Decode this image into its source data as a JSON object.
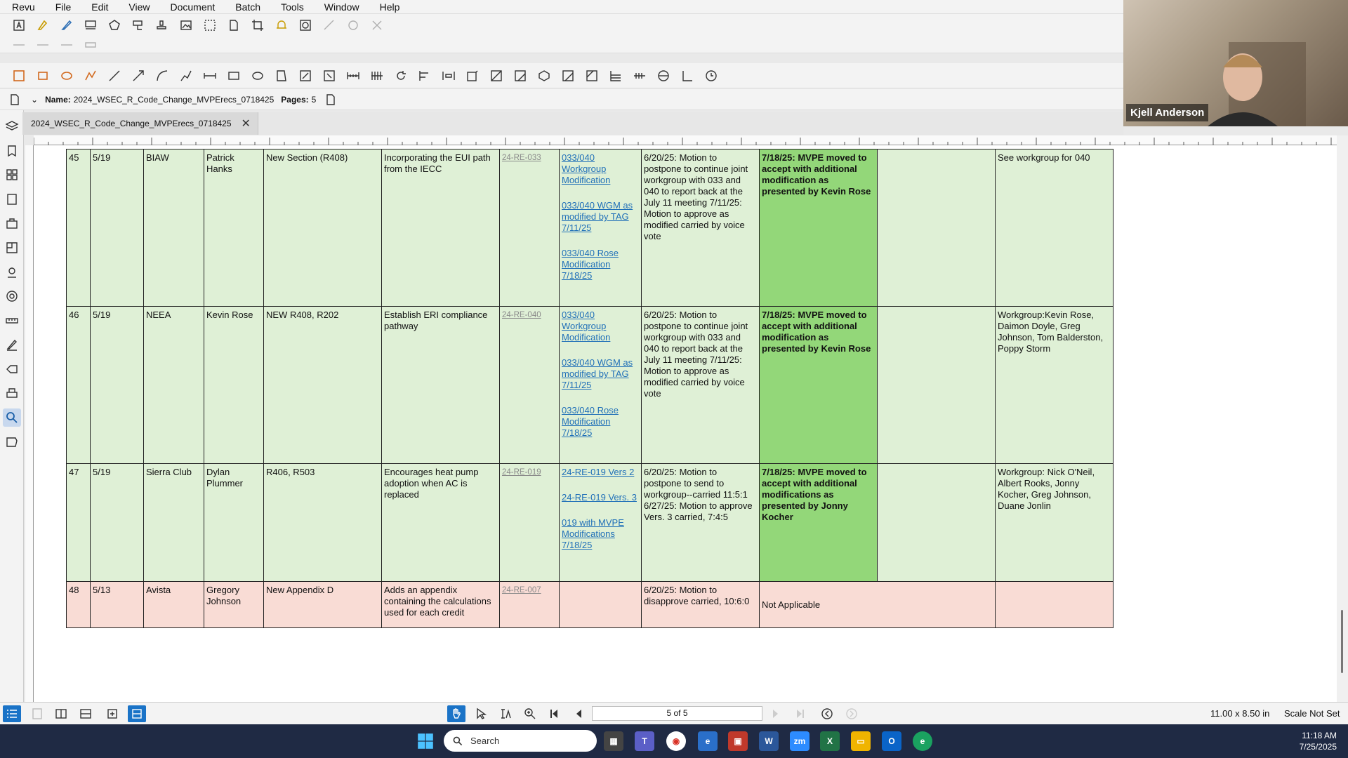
{
  "menu": [
    "Revu",
    "File",
    "Edit",
    "View",
    "Document",
    "Batch",
    "Tools",
    "Window",
    "Help"
  ],
  "namebar": {
    "name_label": "Name:",
    "name_value": "2024_WSEC_R_Code_Change_MVPErecs_0718425",
    "pages_label": "Pages:",
    "pages_value": "5"
  },
  "tab": {
    "title": "2024_WSEC_R_Code_Change_MVPErecs_0718425"
  },
  "table": {
    "rows": [
      {
        "num": "45",
        "date": "5/19",
        "org": "BIAW",
        "person": "Patrick Hanks",
        "section": "New Section (R408)",
        "desc": "Incorporating the EUI path from the IECC",
        "ref": "24-RE-033",
        "links": [
          "033/040 Workgroup Modification",
          "033/040 WGM as modified by TAG 7/11/25",
          "033/040 Rose Modification 7/18/25"
        ],
        "tag": "6/20/25: Motion to postpone to continue joint workgroup with 033 and 040 to report back at the July 11 meeting 7/11/25: Motion to approve as modified carried by voice vote",
        "decision": "7/18/25: MVPE moved to accept with additional modification as presented by Kevin Rose",
        "notes": "See workgroup for 040",
        "type": "green"
      },
      {
        "num": "46",
        "date": "5/19",
        "org": "NEEA",
        "person": "Kevin Rose",
        "section": "NEW R408, R202",
        "desc": "Establish ERI compliance pathway",
        "ref": "24-RE-040",
        "links": [
          "033/040 Workgroup Modification",
          "033/040 WGM as modified by TAG 7/11/25",
          "033/040 Rose Modification 7/18/25"
        ],
        "tag": "6/20/25: Motion to postpone to continue joint workgroup with 033 and 040 to report back at the July 11 meeting 7/11/25: Motion to approve as modified carried by voice vote",
        "decision": "7/18/25: MVPE moved to accept with additional modification as presented by Kevin Rose",
        "notes": "Workgroup:Kevin Rose, Daimon Doyle, Greg Johnson, Tom Balderston, Poppy Storm",
        "type": "green"
      },
      {
        "num": "47",
        "date": "5/19",
        "org": "Sierra Club",
        "person": "Dylan Plummer",
        "section": "R406, R503",
        "desc": "Encourages heat pump adoption when AC is replaced",
        "ref": "24-RE-019",
        "links": [
          "24-RE-019 Vers 2",
          "24-RE-019 Vers. 3",
          "019 with MVPE Modifications 7/18/25"
        ],
        "tag": "6/20/25: Motion to postpone to send to workgroup--carried 11:5:1 6/27/25: Motion to approve Vers. 3 carried, 7:4:5",
        "decision": "7/18/25: MVPE moved to accept with additional modifications as presented by Jonny Kocher",
        "notes": "Workgroup: Nick O'Neil, Albert Rooks, Jonny Kocher, Greg Johnson, Duane Jonlin",
        "type": "green"
      },
      {
        "num": "48",
        "date": "5/13",
        "org": "Avista",
        "person": "Gregory Johnson",
        "section": "New Appendix D",
        "desc": "Adds an appendix containing the calculations used for each credit",
        "ref": "24-RE-007",
        "links": [],
        "tag": "6/20/25: Motion to disapprove carried, 10:6:0",
        "decision": "Not Applicable",
        "notes": "",
        "type": "red"
      }
    ]
  },
  "bottombar": {
    "page_indicator": "5 of 5",
    "page_size": "11.00 x 8.50 in",
    "scale": "Scale Not Set"
  },
  "taskbar": {
    "search_placeholder": "Search",
    "time": "11:18 AM",
    "date": "7/25/2025"
  },
  "webcam": {
    "name": "Kjell Anderson"
  },
  "colors": {
    "approved_fill": "#93d779",
    "row_green": "#dff0d6",
    "row_red": "#f9dcd5",
    "link": "#1f6fb8",
    "taskbar": "#1f2a44"
  }
}
